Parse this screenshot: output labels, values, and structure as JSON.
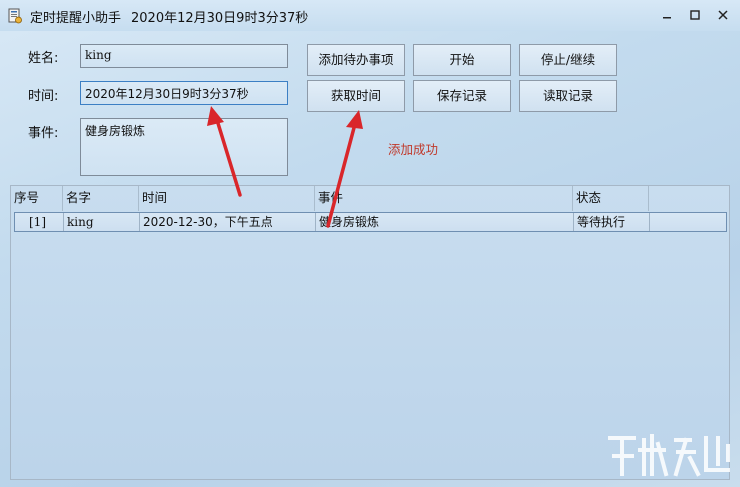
{
  "window": {
    "title": "定时提醒小助手",
    "title_time": "2020年12月30日9时3分37秒"
  },
  "form": {
    "name_label": "姓名:",
    "name_value": "king",
    "time_label": "时间:",
    "time_value": "2020年12月30日9时3分37秒",
    "event_label": "事件:",
    "event_value": "健身房锻炼"
  },
  "buttons": {
    "add": "添加待办事项",
    "start": "开始",
    "pause": "停止/继续",
    "get_time": "获取时间",
    "save": "保存记录",
    "load": "读取记录"
  },
  "status_message": "添加成功",
  "table": {
    "headers": [
      "序号",
      "名字",
      "时间",
      "事件",
      "状态"
    ],
    "rows": [
      [
        "[1]",
        "king",
        "2020-12-30，下午五点",
        "健身房锻炼",
        "等待执行"
      ]
    ]
  },
  "colors": {
    "status_message": "#c0392b",
    "arrow": "#d9262a",
    "focus_border": "#3c7fc4"
  },
  "icons": {
    "app": "app-icon",
    "minimize": "minimize-icon",
    "maximize": "maximize-icon",
    "close": "close-icon"
  }
}
